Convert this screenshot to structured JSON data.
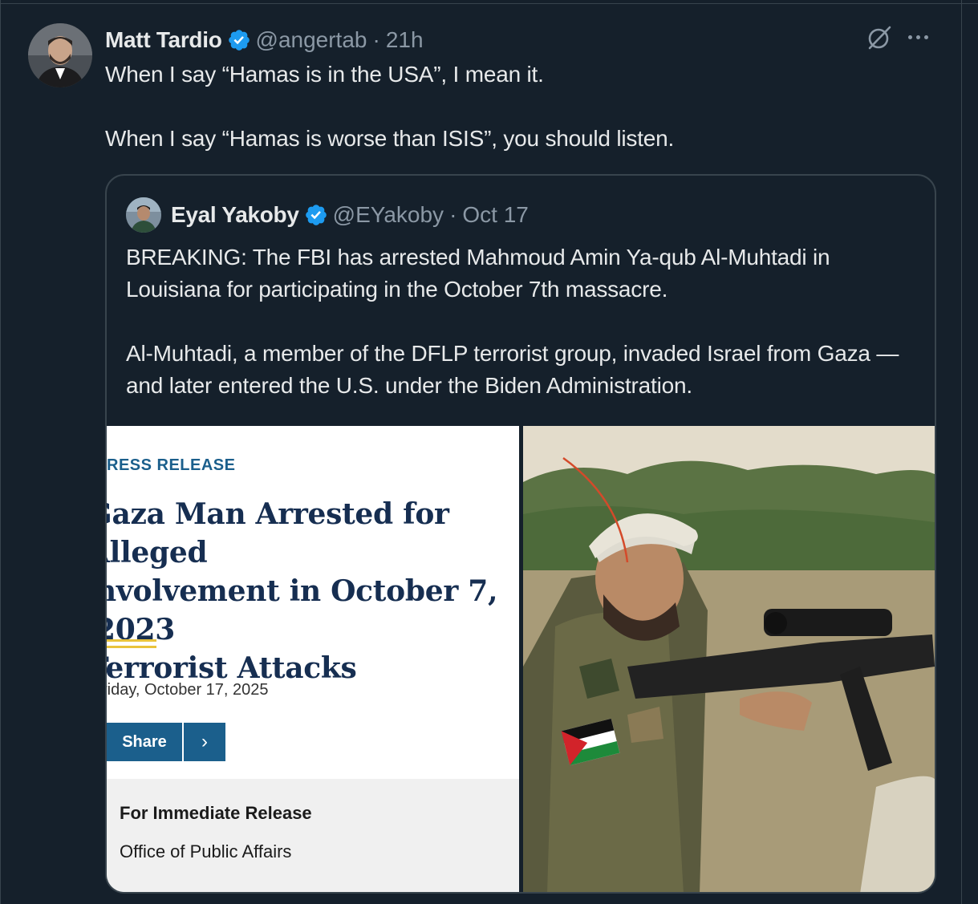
{
  "tweet": {
    "display_name": "Matt Tardio",
    "handle": "@angertab",
    "separator": "·",
    "time": "21h",
    "text_line1": "When I say “Hamas is in the USA”, I mean it.",
    "text_line2": "When I say “Hamas is worse than ISIS”, you should listen."
  },
  "quote": {
    "display_name": "Eyal Yakoby",
    "handle": "@EYakoby",
    "separator": "·",
    "time": "Oct 17",
    "paragraph1": "BREAKING: The FBI has arrested Mahmoud Amin Ya-qub Al-Muhtadi in Louisiana for participating in the October 7th massacre.",
    "paragraph2": "Al-Muhtadi, a member of the DFLP terrorist group, invaded Israel from Gaza — and later entered the U.S. under the Biden Administration."
  },
  "press_release": {
    "label": "RESS RELEASE",
    "title_line1": "Gaza Man Arrested for Alleged",
    "title_line2": "nvolvement in October 7, 2023",
    "title_line3": "Terrorist Attacks",
    "date": "riday, October 17, 2025",
    "share_label": "Share",
    "share_arrow": "›",
    "release_title": "For Immediate Release",
    "release_office": "Office of Public Affairs"
  },
  "colors": {
    "background": "#15202b",
    "verified_blue": "#1d9bf0",
    "doj_blue": "#1b5f8c",
    "doj_navy": "#162e51",
    "doj_gold": "#e9c33b"
  },
  "icons": {
    "verified": "verified-badge-icon",
    "grok": "grok-icon",
    "more": "more-options-icon"
  }
}
